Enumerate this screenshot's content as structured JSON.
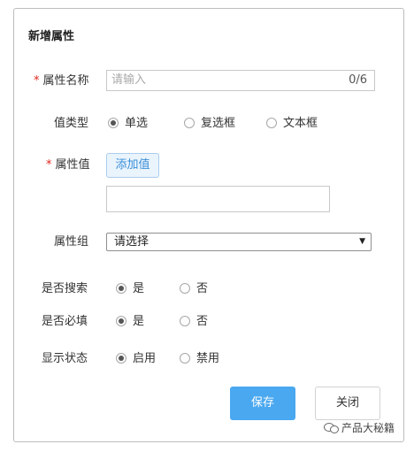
{
  "dialog": {
    "title": "新增属性"
  },
  "form": {
    "name": {
      "required_mark": "*",
      "label": "属性名称",
      "placeholder": "请输入",
      "counter": "0/6"
    },
    "value_type": {
      "label": "值类型",
      "options": [
        {
          "label": "单选",
          "selected": true
        },
        {
          "label": "复选框",
          "selected": false
        },
        {
          "label": "文本框",
          "selected": false
        }
      ]
    },
    "attr_value": {
      "required_mark": "*",
      "label": "属性值",
      "add_label": "添加值",
      "value": ""
    },
    "group": {
      "label": "属性组",
      "selected": "请选择",
      "arrow": "▼"
    },
    "searchable": {
      "label": "是否搜索",
      "options": [
        {
          "label": "是",
          "selected": true
        },
        {
          "label": "否",
          "selected": false
        }
      ]
    },
    "required": {
      "label": "是否必填",
      "options": [
        {
          "label": "是",
          "selected": true
        },
        {
          "label": "否",
          "selected": false
        }
      ]
    },
    "display_state": {
      "label": "显示状态",
      "options": [
        {
          "label": "启用",
          "selected": true
        },
        {
          "label": "禁用",
          "selected": false
        }
      ]
    }
  },
  "actions": {
    "save_label": "保存",
    "close_label": "关闭"
  },
  "watermark": {
    "text": "产品大秘籍"
  },
  "colors": {
    "primary": "#4aa8f0",
    "required": "#e0251b",
    "add_bg": "#eaf4fd",
    "add_text": "#3a8fd8"
  }
}
